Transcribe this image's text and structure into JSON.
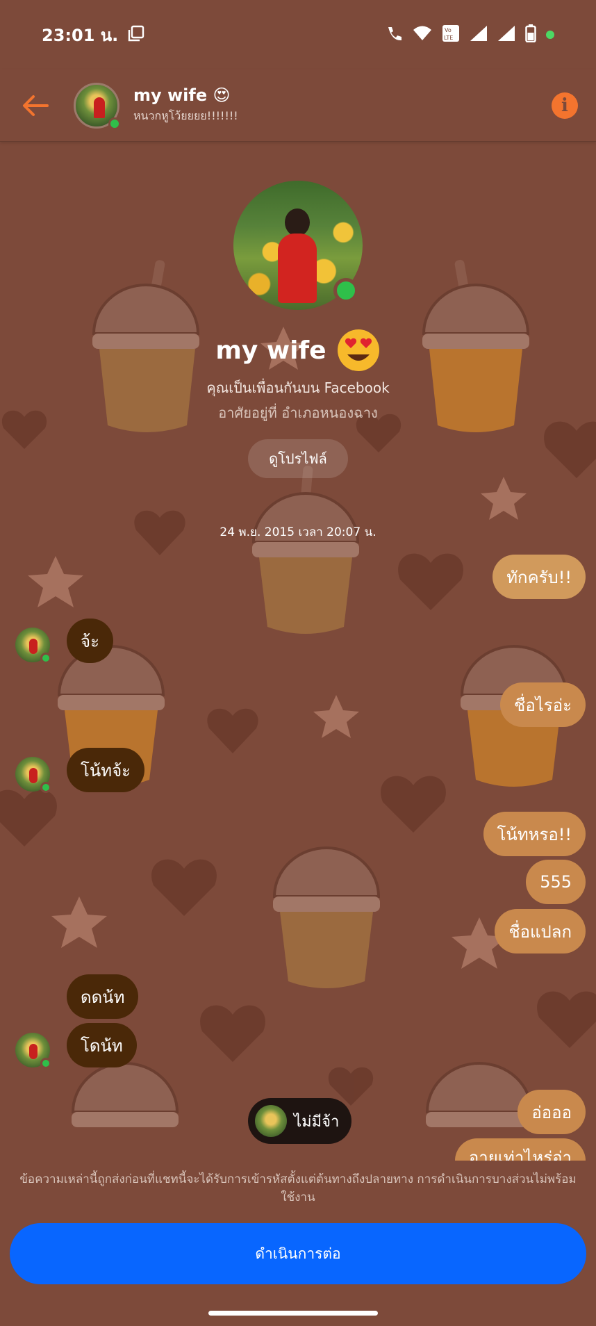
{
  "status_bar": {
    "time": "23:01 น.",
    "icons": [
      "screenshot-icon",
      "wifi-call-icon",
      "wifi-icon",
      "volte-icon",
      "signal-icon",
      "battery-icon"
    ]
  },
  "header": {
    "name": "my wife 😍",
    "subtitle": "หนวกหูโว้ยยยย!!!!!!!",
    "back_icon": "arrow-left-icon",
    "info_icon": "info-icon"
  },
  "profile": {
    "name": "my wife",
    "friends_text": "คุณเป็นเพื่อนกันบน Facebook",
    "lives_text": "อาศัยอยู่ที่ อำเภอหนองฉาง",
    "view_profile_label": "ดูโปรไฟล์"
  },
  "conversation": {
    "date_stamp": "24 พ.ย. 2015 เวลา 20:07 น.",
    "messages": [
      {
        "from": "me",
        "text": "ทักครับ!!"
      },
      {
        "from": "them",
        "text": "จ้ะ"
      },
      {
        "from": "me",
        "text": "ชื่อไรอ่ะ"
      },
      {
        "from": "them",
        "text": "โน้ทจ้ะ"
      },
      {
        "from": "me",
        "text": "โน้ทหรอ!!"
      },
      {
        "from": "me",
        "text": "555"
      },
      {
        "from": "me",
        "text": "ชื่อแปลก"
      },
      {
        "from": "them",
        "text": "ดดน้ท"
      },
      {
        "from": "them",
        "text": "โดน้ท"
      },
      {
        "from": "me",
        "text": "อ่อออ"
      },
      {
        "from": "me",
        "text": "อายุเท่าไหร่อ่า"
      }
    ],
    "typing_preview": "ไม่มีจ้า"
  },
  "footer": {
    "notice": "ข้อความเหล่านี้ถูกส่งก่อนที่แชทนี้จะได้รับการเข้ารหัสตั้งแต่ต้นทางถึงปลายทาง การดำเนินการบางส่วนไม่พร้อมใช้งาน",
    "continue_label": "ดำเนินการต่อ"
  },
  "colors": {
    "background": "#7d4a3a",
    "outgoing_bubble": "#c9894d",
    "incoming_bubble": "#4a2808",
    "accent": "#f3742e",
    "button": "#0866ff",
    "online": "#2fbf4a"
  }
}
